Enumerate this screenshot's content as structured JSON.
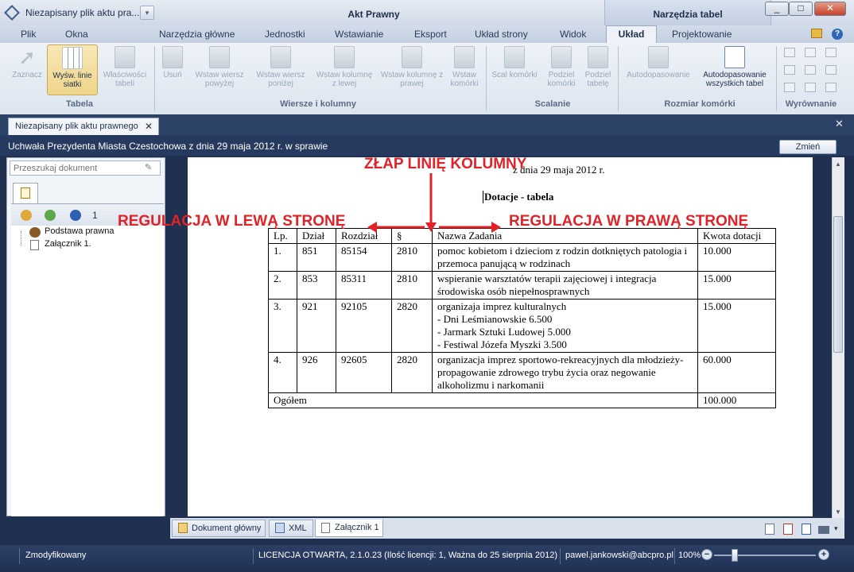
{
  "title_bar": {
    "app_title": "Niezapisany plik aktu pra...",
    "context_akt": "Akt Prawny",
    "context_tabel": "Narzędzia tabel",
    "min": "_",
    "max": "□",
    "close": "✕"
  },
  "ribbon_tabs": [
    "Plik",
    "Okna",
    "Narzędzia główne",
    "Jednostki",
    "Wstawianie",
    "Eksport",
    "Układ strony",
    "Widok",
    "Układ",
    "Projektowanie"
  ],
  "ribbon": {
    "tabela": {
      "caption": "Tabela",
      "zaznacz": "Zaznacz",
      "wysw_linie": "Wyśw. linie siatki",
      "wlasciwosci": "Właściwości tabeli"
    },
    "wiersze": {
      "caption": "Wiersze i kolumny",
      "usun": "Usuń",
      "wstaw_powyzej": "Wstaw wiersz powyżej",
      "wstaw_ponizej": "Wstaw wiersz poniżej",
      "wstaw_lewej": "Wstaw kolumnę z lewej",
      "wstaw_prawej": "Wstaw kolumnę z prawej",
      "wstaw_komorki": "Wstaw komórki"
    },
    "scalanie": {
      "caption": "Scalanie",
      "scal": "Scal komórki",
      "podziel_komorki": "Podziel komórki",
      "podziel_tabele": "Podziel tabelę"
    },
    "rozmiar": {
      "caption": "Rozmiar komórki",
      "autodopasowanie": "Autodopasowanie",
      "auto_wszystkich": "Autodopasowanie wszystkich tabel"
    },
    "wyrownanie": {
      "caption": "Wyrównanie"
    }
  },
  "doc_tab": {
    "label": "Niezapisany plik aktu prawnego",
    "close": "✕"
  },
  "doc_heading": "Uchwała Prezydenta Miasta Czestochowa z dnia 29 maja 2012 r. w sprawie",
  "zmien_button": "Zmień",
  "left_pane": {
    "search_placeholder": "Przeszukaj dokument",
    "count": "1",
    "tree": [
      "Podstawa prawna",
      "Załącznik 1."
    ]
  },
  "document": {
    "date_line": "z dnia 29 maja 2012 r.",
    "heading": "Dotacje - tabela",
    "table": {
      "headers": [
        "Lp.",
        "Dział",
        "Rozdział",
        "§",
        "Nazwa Zadania",
        "Kwota dotacji"
      ],
      "rows": [
        [
          "1.",
          "851",
          "85154",
          "2810",
          "pomoc kobietom i dzieciom z rodzin dotkniętych patologia i przemoca panującą w rodzinach",
          "10.000"
        ],
        [
          "2.",
          "853",
          "85311",
          "2810",
          "wspieranie warsztatów terapii zajęciowej i integracja środowiska osób niepełnosprawnych",
          "15.000"
        ],
        [
          "3.",
          "921",
          "92105",
          "2820",
          "organizaja imprez kulturalnych\n- Dni Leśmianowskie 6.500\n- Jarmark Sztuki Ludowej 5.000\n- Festiwal Józefa Myszki 3.500",
          "15.000"
        ],
        [
          "4.",
          "926",
          "92605",
          "2820",
          "organizacja imprez sportowo-rekreacyjnych dla młodzieży- propagowanie zdrowego trybu życia oraz negowanie alkoholizmu i narkomanii",
          "60.000"
        ]
      ],
      "total_label": "Ogółem",
      "total_value": "100.000"
    }
  },
  "annotations": {
    "top": "ZŁAP LINIĘ KOLUMNY",
    "left": "REGULACJA W LEWĄ STRONĘ",
    "right": "REGULACJA W PRAWĄ STRONĘ"
  },
  "bottom_tabs": [
    "Dokument główny",
    "XML",
    "Załącznik 1"
  ],
  "status": {
    "state": "Zmodyfikowany",
    "license": "LICENCJA OTWARTA, 2.1.0.23 (Ilość licencji: 1, Ważna do 25 sierpnia 2012)",
    "email": "pawel.jankowski@abcpro.pl",
    "zoom": "100%"
  },
  "colors": {
    "annotation": "#e32228",
    "selected_button": "#eed58a",
    "status_bar": "#22345a"
  }
}
